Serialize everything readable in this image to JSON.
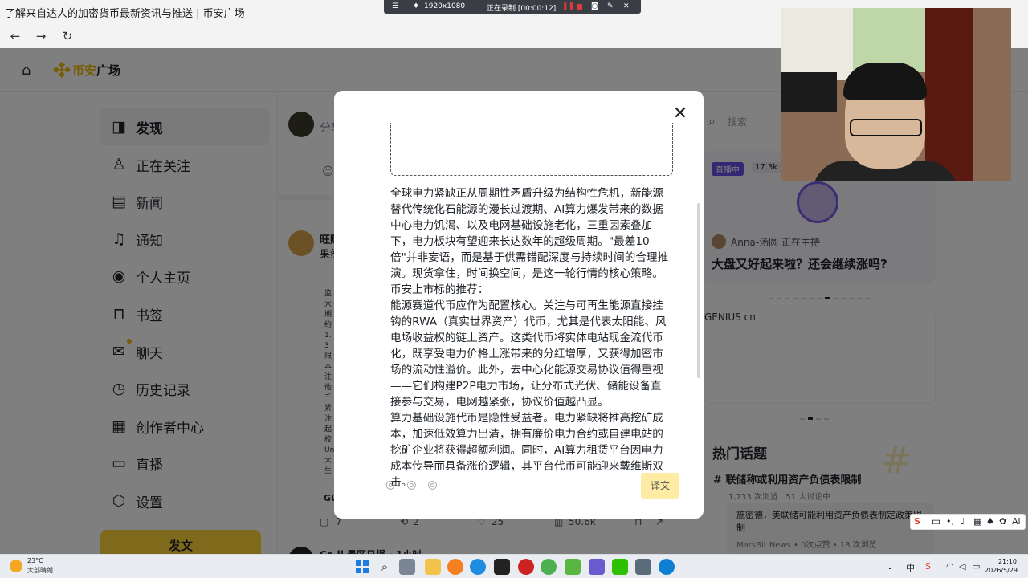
{
  "browser": {
    "tab_title": "了解来自达人的加密货币最新资讯与推送 | 币安广场",
    "back": "←",
    "forward": "→",
    "reload": "↻"
  },
  "recording": {
    "resolution": "1920x1080",
    "status": "正在录制 [00:00:12]"
  },
  "header": {
    "brand_prefix": "币安",
    "brand_suffix": "广场"
  },
  "sidebar": {
    "items": [
      {
        "label": "发现",
        "icon": "discover-icon",
        "glyph": "◨"
      },
      {
        "label": "正在关注",
        "icon": "following-icon",
        "glyph": "♙"
      },
      {
        "label": "新闻",
        "icon": "news-icon",
        "glyph": "▤"
      },
      {
        "label": "通知",
        "icon": "bell-icon",
        "glyph": "♫"
      },
      {
        "label": "个人主页",
        "icon": "profile-icon",
        "glyph": "◉"
      },
      {
        "label": "书签",
        "icon": "bookmark-icon",
        "glyph": "⊓"
      },
      {
        "label": "聊天",
        "icon": "chat-icon",
        "glyph": "✉"
      },
      {
        "label": "历史记录",
        "icon": "history-icon",
        "glyph": "◷"
      },
      {
        "label": "创作者中心",
        "icon": "creator-icon",
        "glyph": "▦"
      },
      {
        "label": "直播",
        "icon": "live-icon",
        "glyph": "▭"
      },
      {
        "label": "设置",
        "icon": "settings-icon",
        "glyph": "⬡"
      }
    ],
    "post_button": "发文"
  },
  "feed": {
    "composer_placeholder": "分享",
    "post_author": "旺财",
    "post_snippet": "果然",
    "post_column_text": "监大期约1.3限本注他千紧注起校Un大生",
    "post_tag": "GU",
    "stats": {
      "comments": "7",
      "reposts": "2",
      "likes": "25",
      "views": "50.6k"
    },
    "next_author": "Co.ll 景区日报",
    "next_time": "1小时"
  },
  "right": {
    "search_placeholder": "搜索",
    "live_badge": "直播中",
    "live_count": "17.3k",
    "host_name": "Anna-汤圆",
    "host_status": "正在主持",
    "live_title": "大盘又好起来啦？还会继续涨吗?",
    "banner_alt": "GENIUS cn",
    "hot_title": "热门话题",
    "topic": "联储称或利用资产负债表限制",
    "topic_views": "1,733 次浏览",
    "topic_discuss": "51 人讨论中",
    "news_text": "施密德，美联储可能利用资产负债表制定政策限制",
    "news_meta": "MarsBit News • 0次点赞 • 18 次浏览"
  },
  "modal": {
    "close": "✕",
    "article": "全球电力紧缺正从周期性矛盾升级为结构性危机，新能源替代传统化石能源的漫长过渡期、AI算力爆发带来的数据中心电力饥渴、以及电网基础设施老化，三重因素叠加下，电力板块有望迎来长达数年的超级周期。\"最差10倍\"并非妄语，而是基于供需错配深度与持续时间的合理推演。现货拿住，时间换空间，是这一轮行情的核心策略。\n币安上市标的推荐：\n能源赛道代币应作为配置核心。关注与可再生能源直接挂钩的RWA（真实世界资产）代币，尤其是代表太阳能、风电场收益权的链上资产。这类代币将实体电站现金流代币化，既享受电力价格上涨带来的分红增厚，又获得加密市场的流动性溢价。此外，去中心化能源交易协议值得重视——它们构建P2P电力市场，让分布式光伏、储能设备直接参与交易，电网越紧张，协议价值越凸显。\n算力基础设施代币是隐性受益者。电力紧缺将推高挖矿成本，加速低效算力出清，拥有廉价电力合约或自建电站的挖矿企业将获得超额利润。同时，AI算力租赁平台因电力成本传导而具备涨价逻辑，其平台代币可能迎来戴维斯双击。",
    "translate": "译文"
  },
  "ime": {
    "lang": "中",
    "sym": "•,",
    "full": "⌚"
  },
  "taskbar": {
    "temp": "23°C",
    "weather": "大部晴朗",
    "tray_lang": "中",
    "time": "21:10",
    "date": "2026/5/29"
  }
}
